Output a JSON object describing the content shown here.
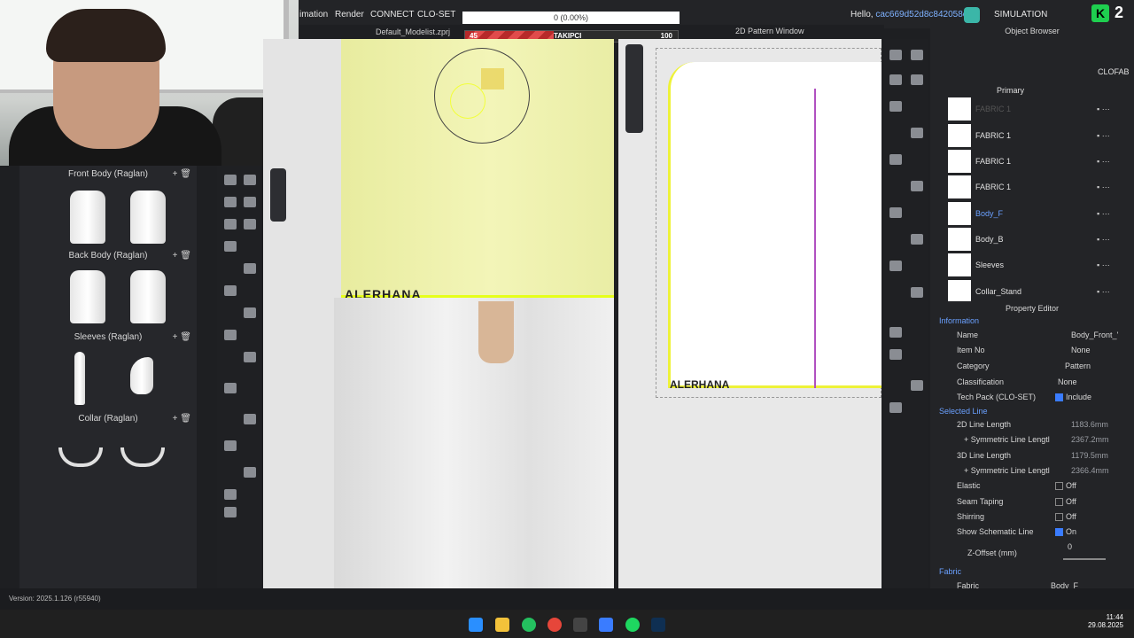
{
  "menu": {
    "animation": "imation",
    "render": "Render",
    "connect": "CONNECT",
    "closet": "CLO-SET"
  },
  "progress_text": "0 (0.00%)",
  "header": {
    "hello": "Hello,",
    "user_id": "cac669d52d8c842058c3",
    "mode": "SIMULATION",
    "app_badge": "2"
  },
  "file_tab": "Default_Modelist.zprj",
  "banner": {
    "left_num": "45",
    "label": "TAKIPCI",
    "right_num": "100"
  },
  "pattern_window_title": "2D Pattern Window",
  "library": {
    "groups": [
      {
        "label": "Front Body (Raglan)"
      },
      {
        "label": "Back Body (Raglan)"
      },
      {
        "label": "Sleeves (Raglan)"
      },
      {
        "label": "Collar (Raglan)"
      }
    ]
  },
  "viewport_brand": "ALERHANA",
  "object_browser": {
    "title": "Object Browser",
    "tab": "CLOFAB",
    "primary": "Primary",
    "fabrics": [
      {
        "name": "FABRIC 1"
      },
      {
        "name": "FABRIC 1"
      },
      {
        "name": "FABRIC 1"
      },
      {
        "name": "FABRIC 1"
      },
      {
        "name": "Body_F"
      },
      {
        "name": "Body_B"
      },
      {
        "name": "Sleeves"
      },
      {
        "name": "Collar_Stand"
      }
    ]
  },
  "property_editor": {
    "title": "Property Editor",
    "information": "Information",
    "name_label": "Name",
    "name_value": "Body_Front_'",
    "itemno_label": "Item No",
    "itemno_value": "None",
    "category_label": "Category",
    "category_value": "Pattern",
    "classification_label": "Classification",
    "classification_value": "None",
    "techpack_label": "Tech Pack (CLO-SET)",
    "techpack_value": "Include",
    "selected_line": "Selected Line",
    "len2d_label": "2D Line Length",
    "len2d_value": "1183.6mm",
    "sym2d_label": "+ Symmetric Line Lengtl",
    "sym2d_value": "2367.2mm",
    "len3d_label": "3D Line Length",
    "len3d_value": "1179.5mm",
    "sym3d_label": "+ Symmetric Line Lengtl",
    "sym3d_value": "2366.4mm",
    "elastic_label": "Elastic",
    "elastic_value": "Off",
    "seam_label": "Seam Taping",
    "seam_value": "Off",
    "shirring_label": "Shirring",
    "shirring_value": "Off",
    "schematic_label": "Show Schematic Line",
    "schematic_value": "On",
    "zoffset_label": "Z-Offset (mm)",
    "zoffset_value": "0",
    "fabric_section": "Fabric",
    "fabric_label": "Fabric",
    "fabric_value": "Body_F"
  },
  "version": "Version: 2025.1.126 (r55940)",
  "clock": {
    "time": "11:44",
    "date": "29.08.2025"
  },
  "colors": {
    "accent": "#3a7cff",
    "highlight_line": "#eef238",
    "shirt": "#f0f3b2"
  }
}
